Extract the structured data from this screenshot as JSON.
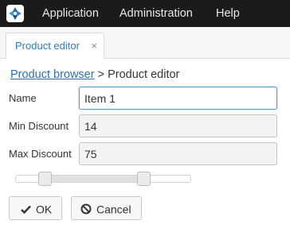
{
  "menubar": {
    "items": [
      {
        "label": "Application"
      },
      {
        "label": "Administration"
      },
      {
        "label": "Help"
      }
    ]
  },
  "tabs": [
    {
      "label": "Product editor",
      "close": "×",
      "active": true
    }
  ],
  "breadcrumb": {
    "link": "Product browser",
    "separator": ">",
    "current": "Product editor"
  },
  "form": {
    "name": {
      "label": "Name",
      "value": "Item 1"
    },
    "min_discount": {
      "label": "Min Discount",
      "value": "14"
    },
    "max_discount": {
      "label": "Max Discount",
      "value": "75"
    }
  },
  "slider": {
    "min": 0,
    "max": 100,
    "low": 14,
    "high": 75
  },
  "buttons": {
    "ok": {
      "label": "OK",
      "icon": "checkmark-icon"
    },
    "cancel": {
      "label": "Cancel",
      "icon": "ban-icon"
    }
  },
  "colors": {
    "topbar": "#1b1b1b",
    "link": "#2e6fad",
    "focus_border": "#5b9bd5"
  }
}
